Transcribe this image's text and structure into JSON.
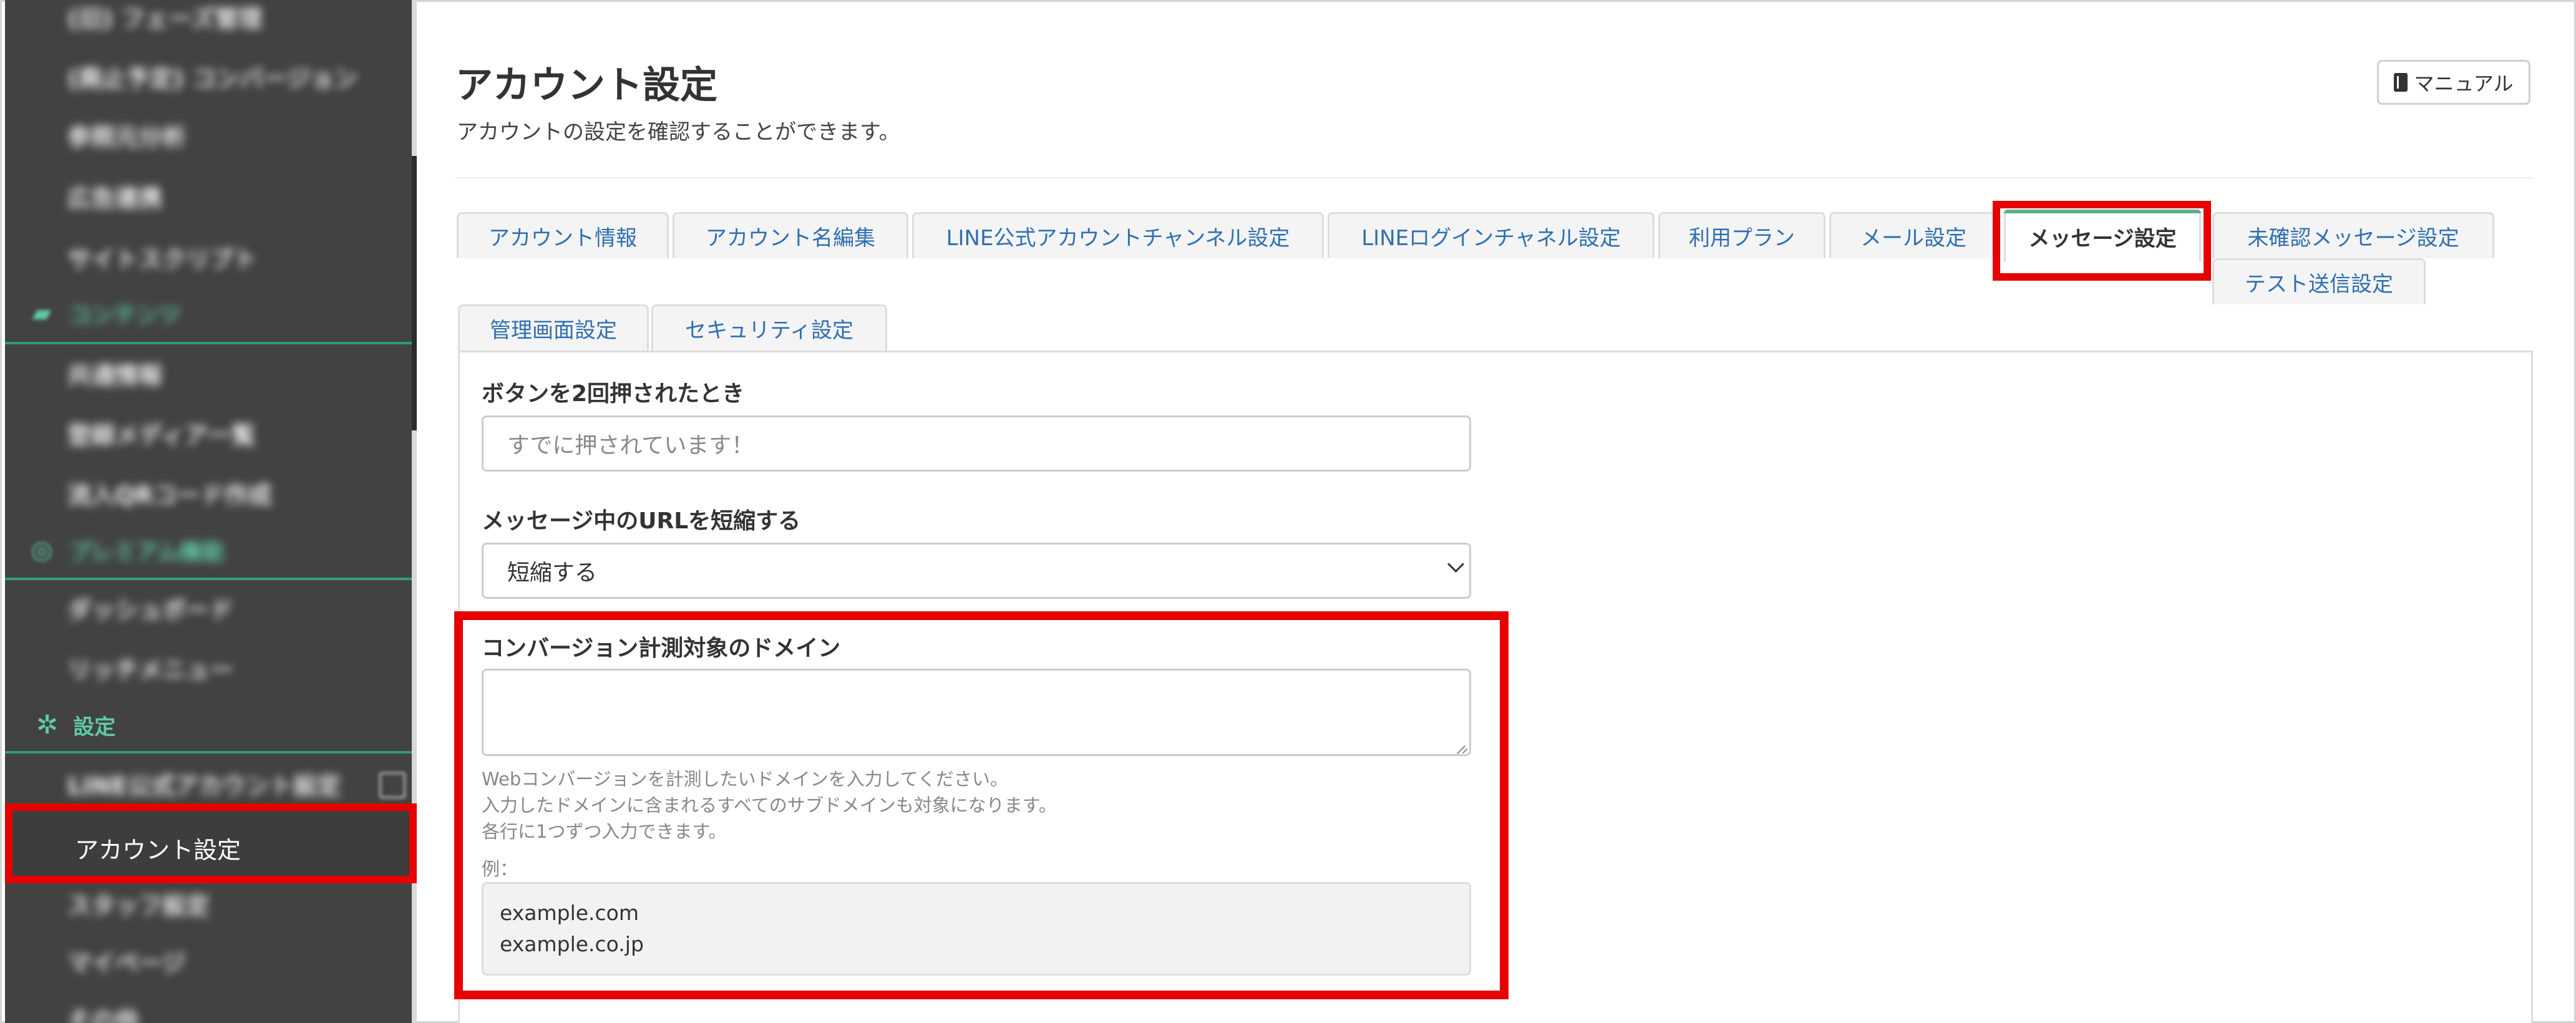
{
  "sidebar": {
    "blurred_items": [
      {
        "label": "(旧) フェーズ管理"
      },
      {
        "label": "(廃止予定) コンバージョン"
      },
      {
        "label": "参照元分析"
      },
      {
        "label": "広告連携"
      },
      {
        "label": "サイトスクリプト"
      }
    ],
    "sections": [
      {
        "label": "コンテンツ",
        "icon": "folder-icon",
        "items": [
          {
            "label": "共通情報"
          },
          {
            "label": "登録メディア一覧"
          },
          {
            "label": "流入QRコード作成"
          }
        ]
      },
      {
        "label": "プレミアム機能",
        "icon": "premium-icon",
        "items": [
          {
            "label": "ダッシュボード"
          },
          {
            "label": "リッチメニュー"
          }
        ]
      }
    ],
    "settings": {
      "label": "設定",
      "icon": "gear-icon"
    },
    "settings_items": [
      {
        "label": "LINE公式アカウント設定"
      },
      {
        "label": "アカウント設定",
        "active": true
      },
      {
        "label": "スタッフ設定"
      },
      {
        "label": "マイページ"
      },
      {
        "label": "その他"
      }
    ]
  },
  "header": {
    "title": "アカウント設定",
    "description": "アカウントの設定を確認することができます。",
    "manual_button": {
      "label": "マニュアル",
      "icon": "book-icon"
    }
  },
  "tabs": [
    {
      "label": "アカウント情報",
      "active": false
    },
    {
      "label": "アカウント名編集",
      "active": false
    },
    {
      "label": "LINE公式アカウントチャンネル設定",
      "active": false
    },
    {
      "label": "LINEログインチャネル設定",
      "active": false
    },
    {
      "label": "利用プラン",
      "active": false
    },
    {
      "label": "メール設定",
      "active": false
    },
    {
      "label": "メッセージ設定",
      "active": true
    },
    {
      "label": "未確認メッセージ設定",
      "active": false
    },
    {
      "label": "テスト送信設定",
      "active": false
    },
    {
      "label": "管理画面設定",
      "active": false
    },
    {
      "label": "セキュリティ設定",
      "active": false
    }
  ],
  "form": {
    "double_press": {
      "label": "ボタンを2回押されたとき",
      "placeholder": "すでに押されています！",
      "value": ""
    },
    "shorten_url": {
      "label": "メッセージ中のURLを短縮する",
      "selected": "短縮する"
    },
    "conversion_domain": {
      "label": "コンバージョン計測対象のドメイン",
      "value": "",
      "help": [
        "Webコンバージョンを計測したいドメインを入力してください。",
        "入力したドメインに含まれるすべてのサブドメインも対象になります。",
        "各行に1つずつ入力できます。"
      ],
      "example_label": "例：",
      "examples": [
        "example.com",
        "example.co.jp"
      ]
    }
  },
  "colors": {
    "sidebar_bg": "#424242",
    "accent_green": "#5fc9a6",
    "link_blue": "#2f6fb1",
    "highlight_red": "#e60000"
  }
}
